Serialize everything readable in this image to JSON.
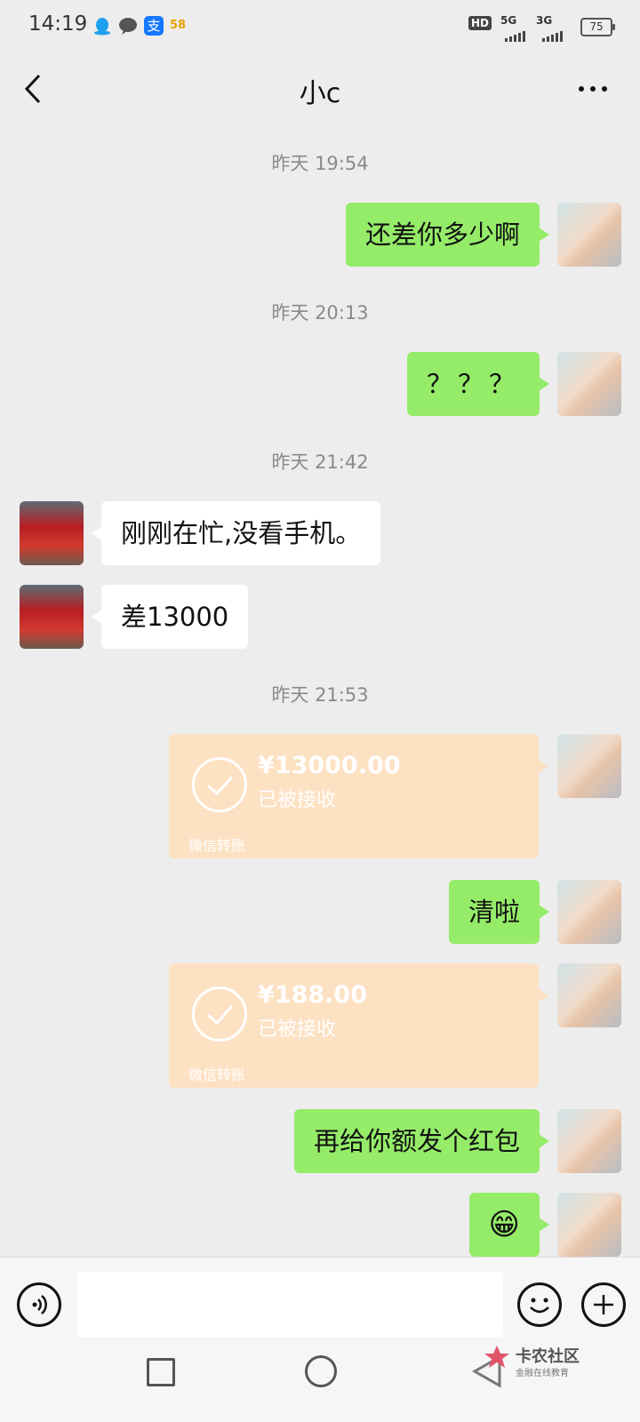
{
  "status_bar": {
    "time": "14:19",
    "app_icons": [
      "qq-icon",
      "wechat-icon",
      "alipay-icon",
      "58-icon"
    ],
    "network1": "5G",
    "network2": "3G",
    "hd_label": "HD",
    "battery": "75"
  },
  "header": {
    "title": "小c",
    "back_icon": "chevron-left-icon",
    "more_icon": "more-dots-icon"
  },
  "messages": {
    "ts1": "昨天 19:54",
    "m1": "还差你多少啊",
    "ts2": "昨天 20:13",
    "m2": "？？？",
    "ts3": "昨天 21:42",
    "m3": "刚刚在忙,没看手机。",
    "m4": "差13000",
    "ts4": "昨天 21:53",
    "transfer1": {
      "amount": "¥13000.00",
      "status": "已被接收",
      "footer": "微信转账"
    },
    "m5": "清啦",
    "transfer2": {
      "amount": "¥188.00",
      "status": "已被接收",
      "footer": "微信转账"
    },
    "m6": "再给你额发个红包",
    "m7": "😁"
  },
  "input_bar": {
    "placeholder": "",
    "voice_icon": "voice-icon",
    "emoji_icon": "emoji-icon",
    "plus_icon": "plus-icon"
  },
  "watermark": {
    "title": "卡农社区",
    "subtitle": "金融在线教育"
  },
  "colors": {
    "bg": "#ededed",
    "my_bubble": "#95ec69",
    "other_bubble": "#ffffff",
    "transfer": "#fde1c3"
  }
}
